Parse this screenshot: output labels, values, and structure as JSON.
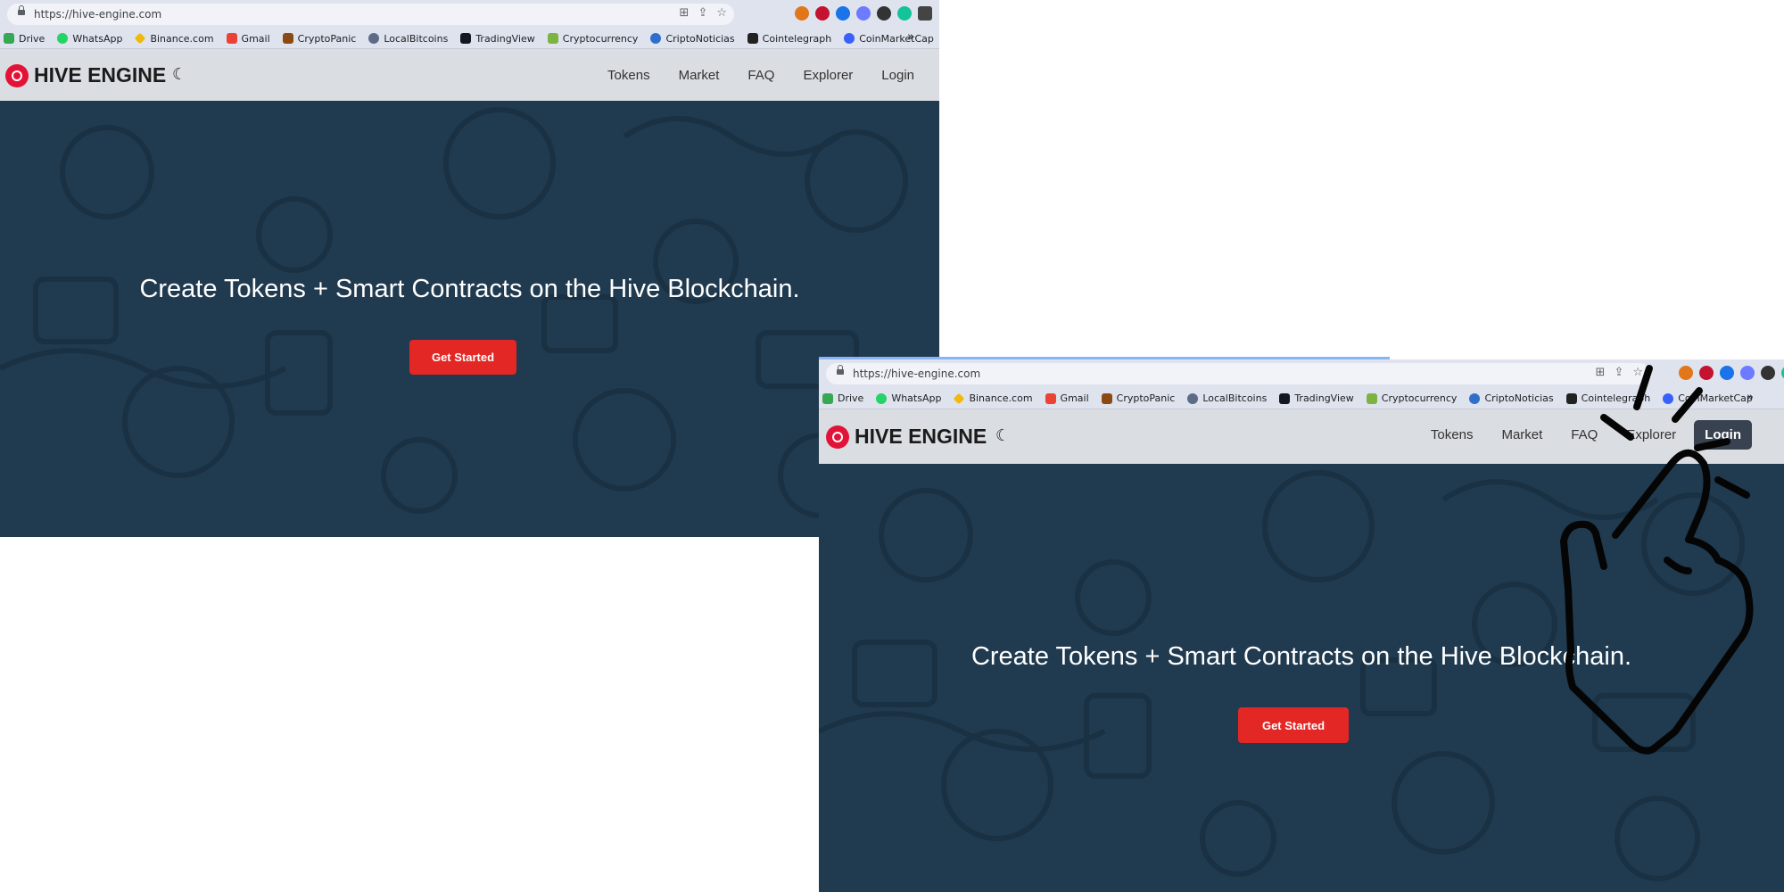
{
  "browser": {
    "url": "https://hive-engine.com",
    "bookmarks": [
      "Drive",
      "WhatsApp",
      "Binance.com",
      "Gmail",
      "CryptoPanic",
      "LocalBitcoins",
      "TradingView",
      "Cryptocurrency",
      "CriptoNoticias",
      "Cointelegraph",
      "CoinMarketCap"
    ],
    "more_label": "»"
  },
  "nav": {
    "logo_text": "HIVE ENGINE",
    "links": [
      "Tokens",
      "Market",
      "FAQ",
      "Explorer",
      "Login"
    ],
    "active_link": "Login"
  },
  "hero": {
    "headline": "Create Tokens + Smart Contracts on the Hive Blockchain.",
    "cta_label": "Get Started"
  },
  "colors": {
    "brand_red": "#e31337",
    "cta_red": "#e32725",
    "hero_bg": "#203a50",
    "nav_bg": "#dadde2",
    "browser_chrome": "#dfe3ee"
  },
  "annotation": {
    "icon": "hand-click-icon",
    "target": "Login"
  }
}
